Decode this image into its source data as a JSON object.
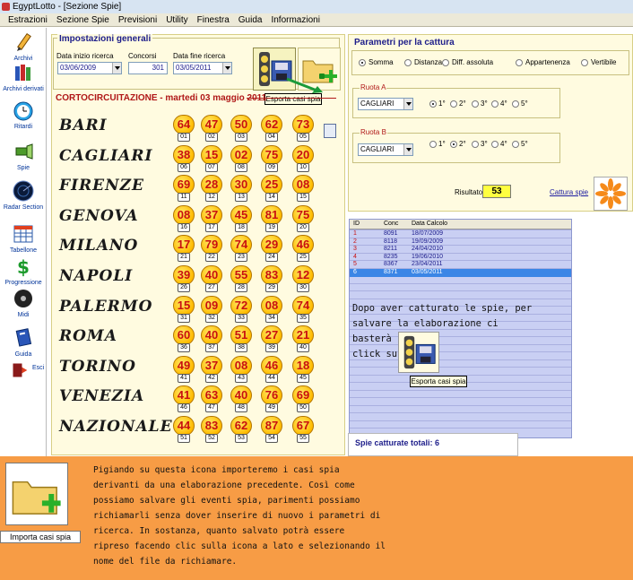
{
  "window": {
    "title": "EgyptLotto - [Sezione Spie]"
  },
  "menu": [
    "Estrazioni",
    "Sezione Spie",
    "Previsioni",
    "Utility",
    "Finestra",
    "Guida",
    "Informazioni"
  ],
  "sidebar": [
    {
      "label": "Archivi",
      "icon": "pencil-icon"
    },
    {
      "label": "Archivi derivati",
      "icon": "books-icon"
    },
    {
      "label": "Ritardi",
      "icon": "stopwatch-icon"
    },
    {
      "label": "Spie",
      "icon": "flashlight-icon"
    },
    {
      "label": "Radar Section",
      "icon": "radar-icon"
    },
    {
      "label": "Tabellone",
      "icon": "table-icon"
    },
    {
      "label": "Progressione",
      "icon": "dollar-icon"
    },
    {
      "label": "Midi",
      "icon": "disc-icon"
    },
    {
      "label": "Guida",
      "icon": "help-book-icon"
    },
    {
      "label": "Esci",
      "icon": "exit-icon"
    }
  ],
  "settings": {
    "legend": "Impostazioni generali",
    "start_label": "Data inizio ricerca",
    "start_value": "03/06/2009",
    "concorsi_label": "Concorsi",
    "concorsi_value": "301",
    "end_label": "Data fine ricerca",
    "end_value": "03/05/2011"
  },
  "tooltip_export": "Esporta casi spia",
  "cortocircuitazione": "CORTOCIRCUITAZIONE - martedi 03 maggio 2011",
  "ruote": [
    {
      "name": "BARI",
      "nums": [
        "64",
        "47",
        "50",
        "62",
        "73"
      ],
      "idx": [
        "01",
        "02",
        "03",
        "04",
        "05"
      ]
    },
    {
      "name": "CAGLIARI",
      "nums": [
        "38",
        "15",
        "02",
        "75",
        "20"
      ],
      "idx": [
        "06",
        "07",
        "08",
        "09",
        "10"
      ]
    },
    {
      "name": "FIRENZE",
      "nums": [
        "69",
        "28",
        "30",
        "25",
        "08"
      ],
      "idx": [
        "11",
        "12",
        "13",
        "14",
        "15"
      ]
    },
    {
      "name": "GENOVA",
      "nums": [
        "08",
        "37",
        "45",
        "81",
        "75"
      ],
      "idx": [
        "16",
        "17",
        "18",
        "19",
        "20"
      ]
    },
    {
      "name": "MILANO",
      "nums": [
        "17",
        "79",
        "74",
        "29",
        "46"
      ],
      "idx": [
        "21",
        "22",
        "23",
        "24",
        "25"
      ]
    },
    {
      "name": "NAPOLI",
      "nums": [
        "39",
        "40",
        "55",
        "83",
        "12"
      ],
      "idx": [
        "26",
        "27",
        "28",
        "29",
        "30"
      ]
    },
    {
      "name": "PALERMO",
      "nums": [
        "15",
        "09",
        "72",
        "08",
        "74"
      ],
      "idx": [
        "31",
        "32",
        "33",
        "34",
        "35"
      ]
    },
    {
      "name": "ROMA",
      "nums": [
        "60",
        "40",
        "51",
        "27",
        "21"
      ],
      "idx": [
        "36",
        "37",
        "38",
        "39",
        "40"
      ]
    },
    {
      "name": "TORINO",
      "nums": [
        "49",
        "37",
        "08",
        "46",
        "18"
      ],
      "idx": [
        "41",
        "42",
        "43",
        "44",
        "45"
      ]
    },
    {
      "name": "VENEZIA",
      "nums": [
        "41",
        "63",
        "40",
        "76",
        "69"
      ],
      "idx": [
        "46",
        "47",
        "48",
        "49",
        "50"
      ]
    },
    {
      "name": "NAZIONALE",
      "nums": [
        "44",
        "83",
        "62",
        "87",
        "67"
      ],
      "idx": [
        "51",
        "52",
        "53",
        "54",
        "55"
      ]
    }
  ],
  "capture": {
    "title": "Parametri per la cattura",
    "modes": [
      "Somma",
      "Distanza",
      "Diff. assoluta",
      "Appartenenza",
      "Vertibile"
    ],
    "mode_selected": 0,
    "ruota_a_label": "Ruota A",
    "ruota_a_value": "CAGLIARI",
    "ruota_a_pos_selected": 0,
    "ruota_b_label": "Ruota B",
    "ruota_b_value": "CAGLIARI",
    "ruota_b_pos_selected": 1,
    "positions": [
      "1°",
      "2°",
      "3°",
      "4°",
      "5°"
    ],
    "risultato_label": "Risultato",
    "risultato_value": "53",
    "cattura_label": "Cattura spie"
  },
  "grid": {
    "headers": [
      "ID",
      "Conc",
      "Data Calcolo"
    ],
    "rows": [
      [
        "1",
        "8091",
        "18/07/2009"
      ],
      [
        "2",
        "8118",
        "19/09/2009"
      ],
      [
        "3",
        "8211",
        "24/04/2010"
      ],
      [
        "4",
        "8235",
        "19/06/2010"
      ],
      [
        "5",
        "8367",
        "23/04/2011"
      ],
      [
        "6",
        "8371",
        "03/05/2011"
      ]
    ],
    "selected_row": 5
  },
  "info": {
    "line1": "Dopo aver catturato le spie, per",
    "line2": "salvare la elaborazione ci basterà fare",
    "line3": "click su",
    "tooltip": "Esporta casi spia"
  },
  "spie_total": "Spie catturate totali: 6",
  "bottom": {
    "caption": "Importa casi spia",
    "lines": [
      "Pigiando su questa icona importeremo i casi spia",
      "derivanti da una elaborazione precedente. Così come",
      "possiamo salvare gli eventi spia, parimenti possiamo",
      "richiamarli senza dover inserire di nuovo i parametri di",
      "ricerca. In sostanza, quanto salvato potrà essere",
      "ripreso facendo clic sulla icona a lato e selezionando il",
      "nome del file da richiamare."
    ]
  }
}
